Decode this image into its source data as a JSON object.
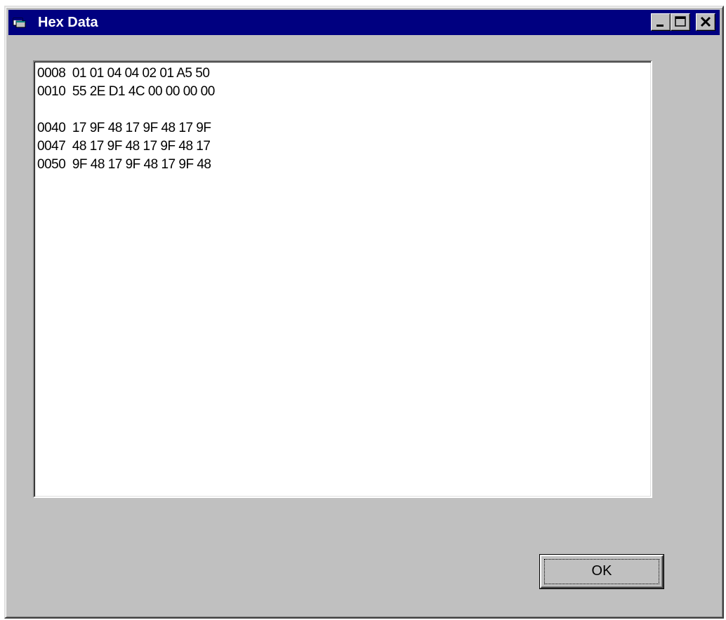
{
  "window": {
    "title": "Hex Data",
    "icon": "app-window-icon"
  },
  "titlebar_buttons": {
    "minimize_icon": "minimize-icon",
    "maximize_icon": "maximize-icon",
    "close_icon": "close-icon"
  },
  "hex_lines": [
    "0008  01 01 04 04 02 01 A5 50",
    "0010  55 2E D1 4C 00 00 00 00",
    "",
    "0040  17 9F 48 17 9F 48 17 9F",
    "0047  48 17 9F 48 17 9F 48 17",
    "0050  9F 48 17 9F 48 17 9F 48"
  ],
  "ok_button": {
    "label": "OK"
  },
  "colors": {
    "titlebar": "#000080",
    "face": "#c0c0c0",
    "textbox_bg": "#ffffff"
  }
}
